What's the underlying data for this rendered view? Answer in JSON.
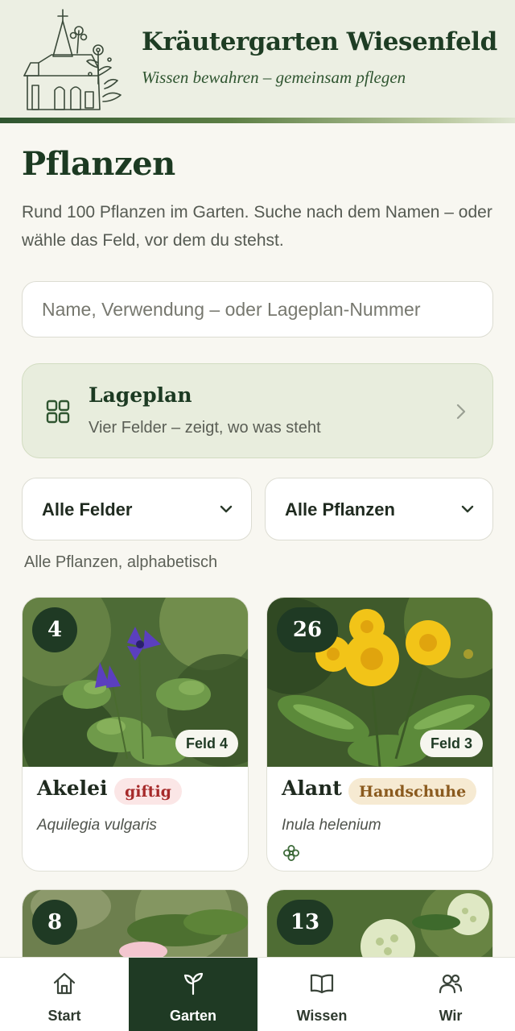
{
  "header": {
    "title": "Kräutergarten Wiesenfeld",
    "tagline": "Wissen bewahren – gemeinsam pflegen"
  },
  "page": {
    "title": "Pflanzen",
    "intro": "Rund 100 Pflanzen im Garten. Suche nach dem Namen – oder wähle das Feld, vor dem du stehst."
  },
  "search": {
    "placeholder": "Name, Verwendung – oder Lageplan-Nummer",
    "value": ""
  },
  "lageplan": {
    "title": "Lageplan",
    "subtitle": "Vier Felder – zeigt, wo was steht",
    "icon": "grid-icon"
  },
  "filters": {
    "feld": {
      "selected": "Alle Felder"
    },
    "pflanzen": {
      "selected": "Alle Pflanzen"
    }
  },
  "list": {
    "caption": "Alle Pflanzen, alphabetisch"
  },
  "plants": [
    {
      "number": "4",
      "feld": "Feld 4",
      "name": "Akelei",
      "tag": "giftig",
      "latin": "Aquilegia vulgaris"
    },
    {
      "number": "26",
      "feld": "Feld 3",
      "name": "Alant",
      "tag": "Handschuhe",
      "latin": "Inula helenium",
      "icon": "flower-icon"
    },
    {
      "number": "8"
    },
    {
      "number": "13"
    }
  ],
  "nav": [
    {
      "label": "Start",
      "icon": "home-icon"
    },
    {
      "label": "Garten",
      "icon": "sprout-icon",
      "active": true
    },
    {
      "label": "Wissen",
      "icon": "book-icon"
    },
    {
      "label": "Wir",
      "icon": "people-icon"
    }
  ],
  "colors": {
    "primary": "#1f3a24",
    "background": "#f8f7f1",
    "header_bg": "#ecefe3",
    "toxic_tag_text": "#a62a2a",
    "glove_tag_text": "#8a5a1e"
  }
}
